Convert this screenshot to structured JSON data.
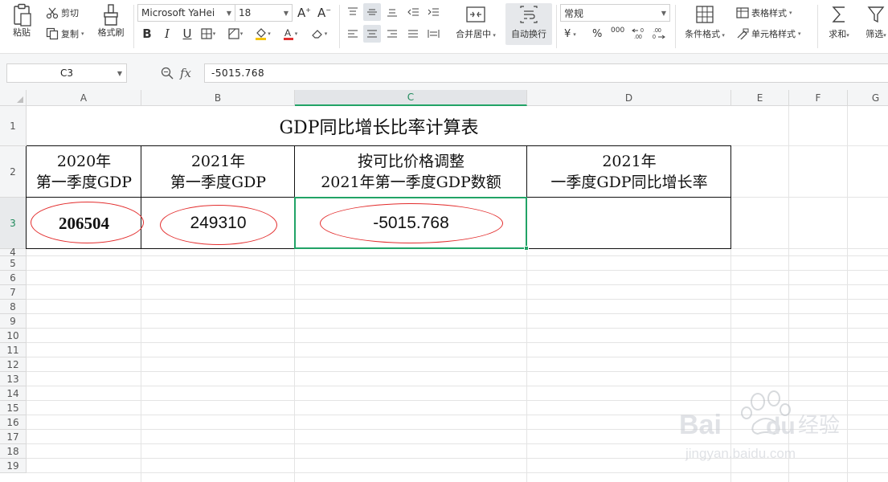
{
  "ribbon": {
    "paste_label": "粘贴",
    "cut_label": "剪切",
    "copy_label": "复制",
    "format_painter_label": "格式刷",
    "font_name": "Microsoft YaHei",
    "font_size": "18",
    "merge_center_label": "合并居中",
    "wrap_text_label": "自动换行",
    "number_format": "常规",
    "currency_symbol": "¥",
    "percent_symbol": "%",
    "thousands_symbol": "000",
    "cond_format_label": "条件格式",
    "table_style_label": "表格样式",
    "cell_style_label": "单元格样式",
    "sum_label": "求和",
    "filter_label": "筛选"
  },
  "formula_bar": {
    "cell_ref": "C3",
    "fx_label": "fx",
    "formula": "-5015.768"
  },
  "columns": [
    "A",
    "B",
    "C",
    "D",
    "E",
    "F",
    "G"
  ],
  "rows": [
    "1",
    "2",
    "3",
    "4",
    "5",
    "6",
    "7",
    "8",
    "9",
    "10",
    "11",
    "12",
    "13",
    "14",
    "15",
    "16",
    "17",
    "18",
    "19"
  ],
  "sheet": {
    "title": "GDP同比增长比率计算表",
    "headers": [
      {
        "line1": "2020年",
        "line2": "第一季度GDP"
      },
      {
        "line1": "2021年",
        "line2": "第一季度GDP"
      },
      {
        "line1": "按可比价格调整",
        "line2": "2021年第一季度GDP数额"
      },
      {
        "line1": "2021年",
        "line2": "一季度GDP同比增长率"
      }
    ],
    "values": [
      "206504",
      "249310",
      "-5015.768",
      ""
    ]
  },
  "colors": {
    "selection_green": "#21a366",
    "annotation_red": "#e32d2d"
  },
  "watermark": {
    "brand": "Bai",
    "brand_tail": "du",
    "brand_cn": "经验",
    "url": "jingyan.baidu.com"
  }
}
